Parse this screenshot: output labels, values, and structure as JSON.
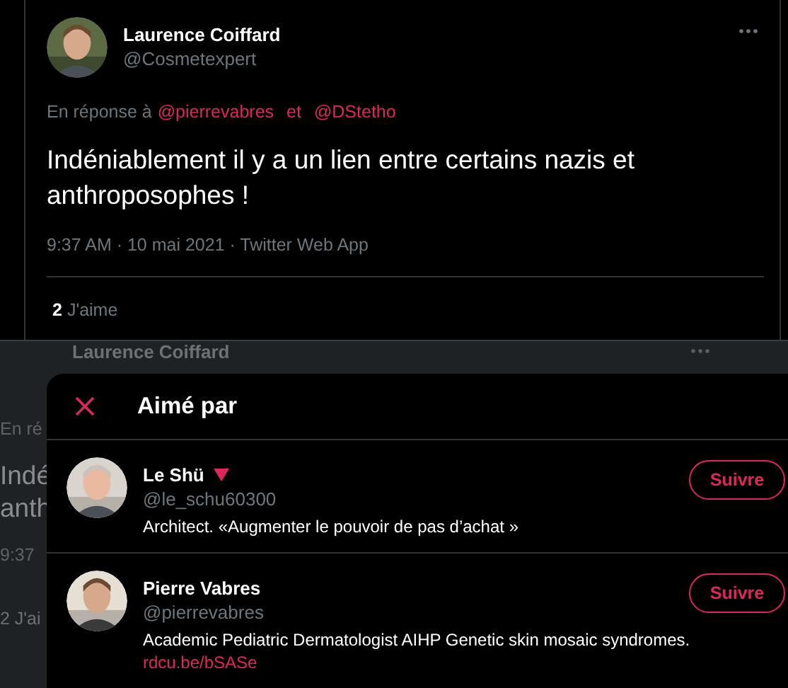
{
  "tweet": {
    "author": {
      "name": "Laurence Coiffard",
      "handle": "@Cosmetexpert"
    },
    "reply_to": {
      "prefix": "En réponse à",
      "mentions": [
        "@pierrevabres",
        "@DStetho"
      ],
      "joiner": "et"
    },
    "text": "Indéniablement il y a un lien entre certains nazis et anthroposophes !",
    "meta": "9:37 AM · 10 mai 2021 · Twitter Web App",
    "likes": {
      "count": "2",
      "label": "J'aime"
    }
  },
  "background_tweet": {
    "name": "Laurence Coiffard",
    "fragments": [
      "En ré",
      "Indé",
      "anth",
      "9:37",
      "2 J'ai"
    ]
  },
  "modal": {
    "title": "Aimé par",
    "users": [
      {
        "name": "Le Shü",
        "triangle": true,
        "handle": "@le_schu60300",
        "bio": "Architect. «Augmenter le pouvoir de pas d’achat »",
        "follow": "Suivre"
      },
      {
        "name": "Pierre Vabres",
        "triangle": false,
        "handle": "@pierrevabres",
        "bio": "Academic Pediatric Dermatologist AIHP Genetic skin mosaic syndromes.",
        "link": "rdcu.be/bSASe",
        "follow": "Suivre"
      }
    ]
  }
}
